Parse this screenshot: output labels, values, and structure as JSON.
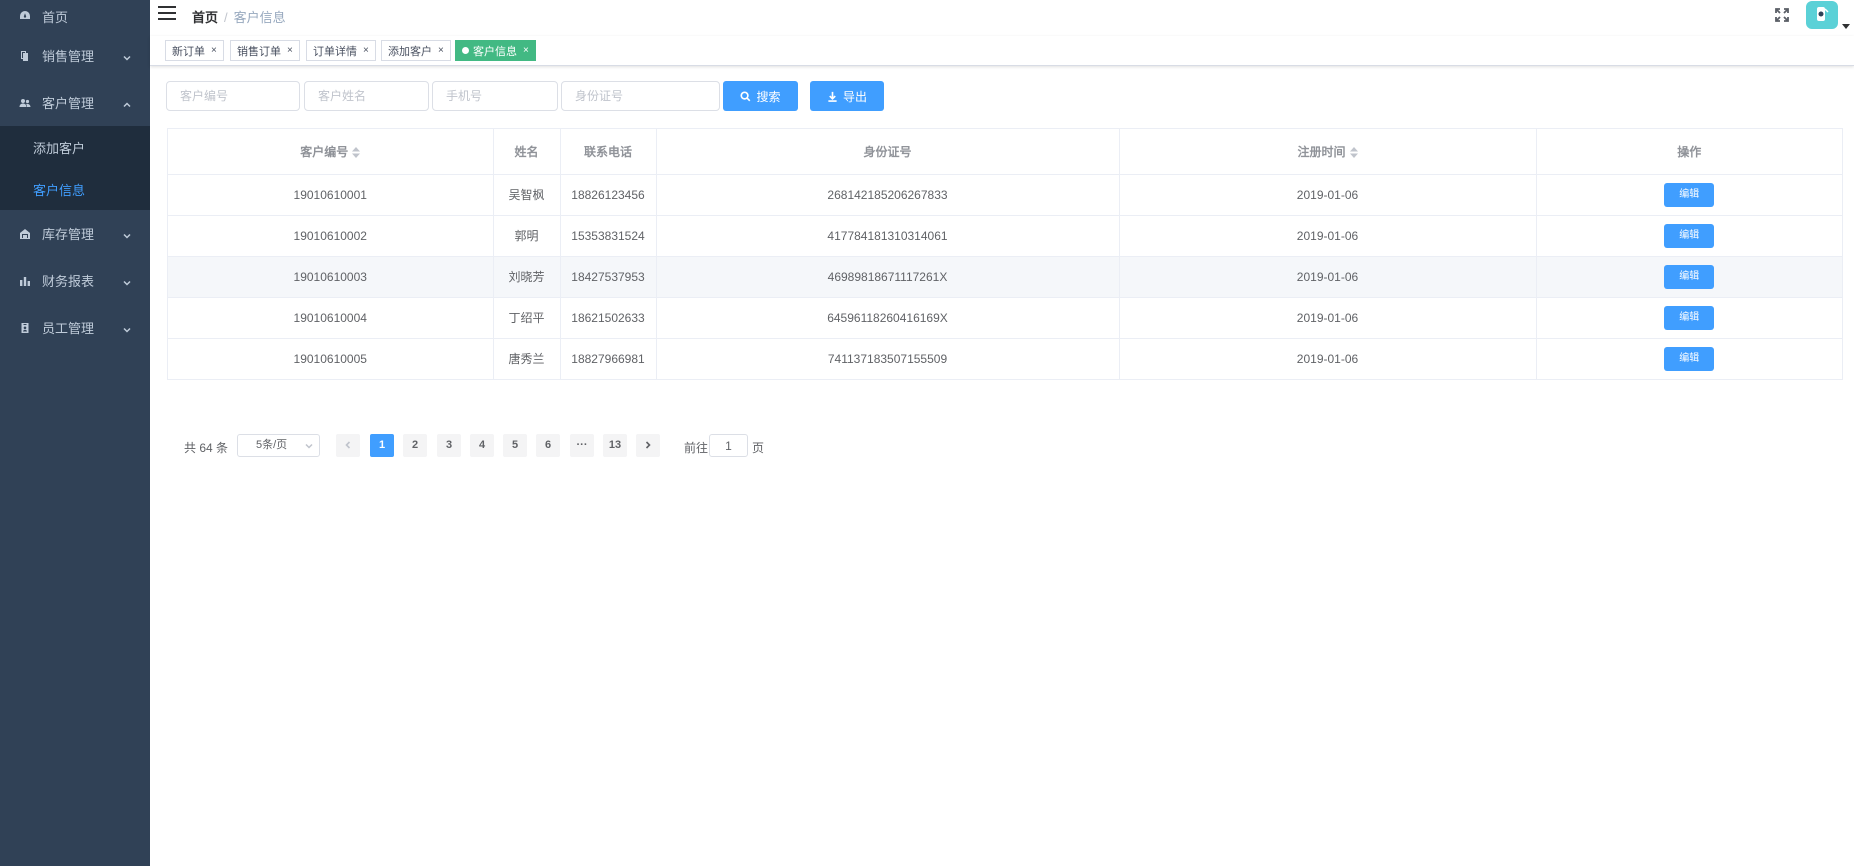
{
  "sidebar": {
    "items": [
      {
        "label": "首页",
        "icon": "dashboard-icon"
      },
      {
        "label": "销售管理",
        "icon": "documents-icon"
      },
      {
        "label": "客户管理",
        "icon": "people-icon"
      },
      {
        "label": "库存管理",
        "icon": "warehouse-icon"
      },
      {
        "label": "财务报表",
        "icon": "chart-icon"
      },
      {
        "label": "员工管理",
        "icon": "badge-icon"
      }
    ],
    "submenu": [
      {
        "label": "添加客户"
      },
      {
        "label": "客户信息"
      }
    ]
  },
  "header": {
    "breadcrumb": {
      "home": "首页",
      "separator": "/",
      "current": "客户信息"
    }
  },
  "tags": [
    {
      "label": "新订单",
      "close": "×"
    },
    {
      "label": "销售订单",
      "close": "×"
    },
    {
      "label": "订单详情",
      "close": "×"
    },
    {
      "label": "添加客户",
      "close": "×"
    },
    {
      "label": "客户信息",
      "close": "×"
    }
  ],
  "filters": {
    "customer_id_placeholder": "客户编号",
    "customer_name_placeholder": "客户姓名",
    "phone_placeholder": "手机号",
    "id_card_placeholder": "身份证号",
    "search_label": "搜索",
    "export_label": "导出"
  },
  "table": {
    "columns": [
      "客户编号",
      "姓名",
      "联系电话",
      "身份证号",
      "注册时间",
      "操作"
    ],
    "edit_label": "编辑",
    "rows": [
      {
        "id": "19010610001",
        "name": "吴智枫",
        "phone": "18826123456",
        "id_card": "268142185206267833",
        "date": "2019-01-06"
      },
      {
        "id": "19010610002",
        "name": "郭明",
        "phone": "15353831524",
        "id_card": "417784181310314061",
        "date": "2019-01-06"
      },
      {
        "id": "19010610003",
        "name": "刘晓芳",
        "phone": "18427537953",
        "id_card": "46989818671117261X",
        "date": "2019-01-06"
      },
      {
        "id": "19010610004",
        "name": "丁绍平",
        "phone": "18621502633",
        "id_card": "64596118260416169X",
        "date": "2019-01-06"
      },
      {
        "id": "19010610005",
        "name": "唐秀兰",
        "phone": "18827966981",
        "id_card": "741137183507155509",
        "date": "2019-01-06"
      }
    ]
  },
  "pagination": {
    "total_text": "共 64 条",
    "page_size": "5条/页",
    "pages": [
      "1",
      "2",
      "3",
      "4",
      "5",
      "6",
      "···",
      "13"
    ],
    "jump_prefix": "前往",
    "jump_value": "1",
    "jump_suffix": "页"
  },
  "colors": {
    "sidebar_bg": "#304156",
    "submenu_bg": "#1f2d3d",
    "primary": "#409eff",
    "active_tag": "#42b983"
  }
}
